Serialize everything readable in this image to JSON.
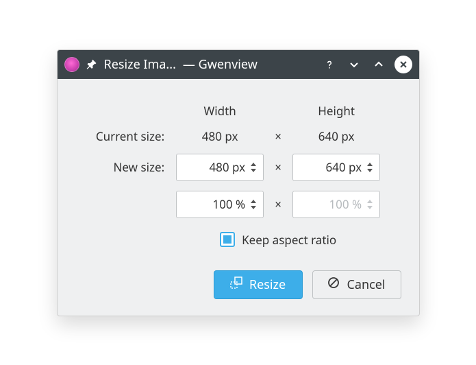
{
  "window": {
    "title_left": "Resize Ima...",
    "title_right": "— Gwenview"
  },
  "headers": {
    "width": "Width",
    "height": "Height"
  },
  "labels": {
    "current_size": "Current size:",
    "new_size": "New size:",
    "keep_aspect": "Keep aspect ratio"
  },
  "current": {
    "width": "480 px",
    "height": "640 px"
  },
  "new_size": {
    "width": "480 px",
    "height": "640 px"
  },
  "percent": {
    "width": "100 %",
    "height": "100 %"
  },
  "separator": "×",
  "buttons": {
    "resize": "Resize",
    "cancel": "Cancel"
  },
  "checkbox": {
    "keep_aspect_checked": true
  },
  "colors": {
    "accent": "#3daee9",
    "titlebar": "#3c4449",
    "panel": "#eff0f1"
  }
}
